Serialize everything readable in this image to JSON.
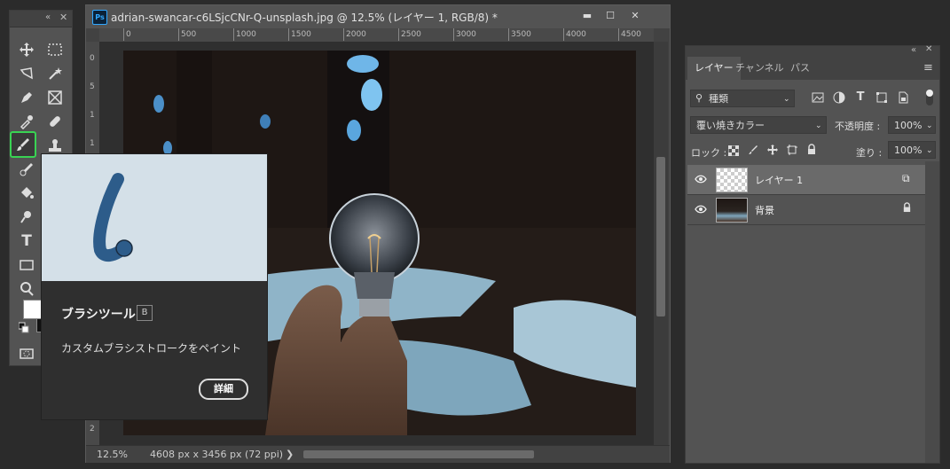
{
  "document": {
    "title": "adrian-swancar-c6LSjcCNr-Q-unsplash.jpg @ 12.5% (レイヤー 1, RGB/8) *",
    "ruler_h_ticks": [
      "0",
      "500",
      "1000",
      "1500",
      "2000",
      "2500",
      "3000",
      "3500",
      "4000",
      "4500"
    ],
    "ruler_v_ticks": [
      "0",
      "5",
      "1",
      "1",
      "2",
      "2"
    ],
    "zoom": "12.5%",
    "size_info": "4608 px x 3456 px (72 ppi)",
    "status_arrow": "❯"
  },
  "window_controls": {
    "minimize": "▬",
    "maximize": "☐",
    "close": "✕"
  },
  "toolbar": {
    "collapse": "«",
    "close": "✕",
    "tools": [
      {
        "icon": "move-tool-icon"
      },
      {
        "icon": "marquee-tool-icon"
      },
      {
        "icon": "lasso-tool-icon"
      },
      {
        "icon": "magic-wand-tool-icon"
      },
      {
        "icon": "pen-tool-icon"
      },
      {
        "icon": "frame-tool-icon"
      },
      {
        "icon": "eyedropper-tool-icon"
      },
      {
        "icon": "healing-brush-tool-icon"
      },
      {
        "icon": "brush-tool-icon",
        "selected": true
      },
      {
        "icon": "stamp-tool-icon"
      },
      {
        "icon": "history-brush-tool-icon"
      },
      {
        "icon": "paint-bucket-tool-icon"
      },
      {
        "icon": "dodge-tool-icon"
      },
      {
        "icon": "type-tool-icon"
      },
      {
        "icon": "rectangle-tool-icon"
      },
      {
        "icon": "zoom-tool-icon"
      }
    ],
    "type_glyph": "T",
    "foreground_color": "#ffffff",
    "background_color": "#111111"
  },
  "tooltip": {
    "title": "ブラシツール",
    "shortcut": "B",
    "description": "カスタムブラシストロークをペイント",
    "more_button": "詳細",
    "preview_color": "#2d5c8a"
  },
  "layers_panel": {
    "tabs": [
      "レイヤー",
      "チャンネル",
      "パス"
    ],
    "active_tab": "レイヤー",
    "collapse": "«",
    "close": "✕",
    "menu": "≡",
    "filter_kind": "種類",
    "blend_mode": "覆い焼きカラー",
    "opacity_label": "不透明度 :",
    "opacity_value": "100%",
    "lock_label": "ロック :",
    "fill_label": "塗り :",
    "fill_value": "100%",
    "layers": [
      {
        "name": "レイヤー 1",
        "selected": true,
        "badge": "⧉"
      },
      {
        "name": "背景",
        "selected": false,
        "badge": "🔒"
      }
    ]
  },
  "colors": {
    "highlight": "#39d353",
    "panel_bg": "#535353",
    "canvas_bg": "#2f2f2f"
  }
}
